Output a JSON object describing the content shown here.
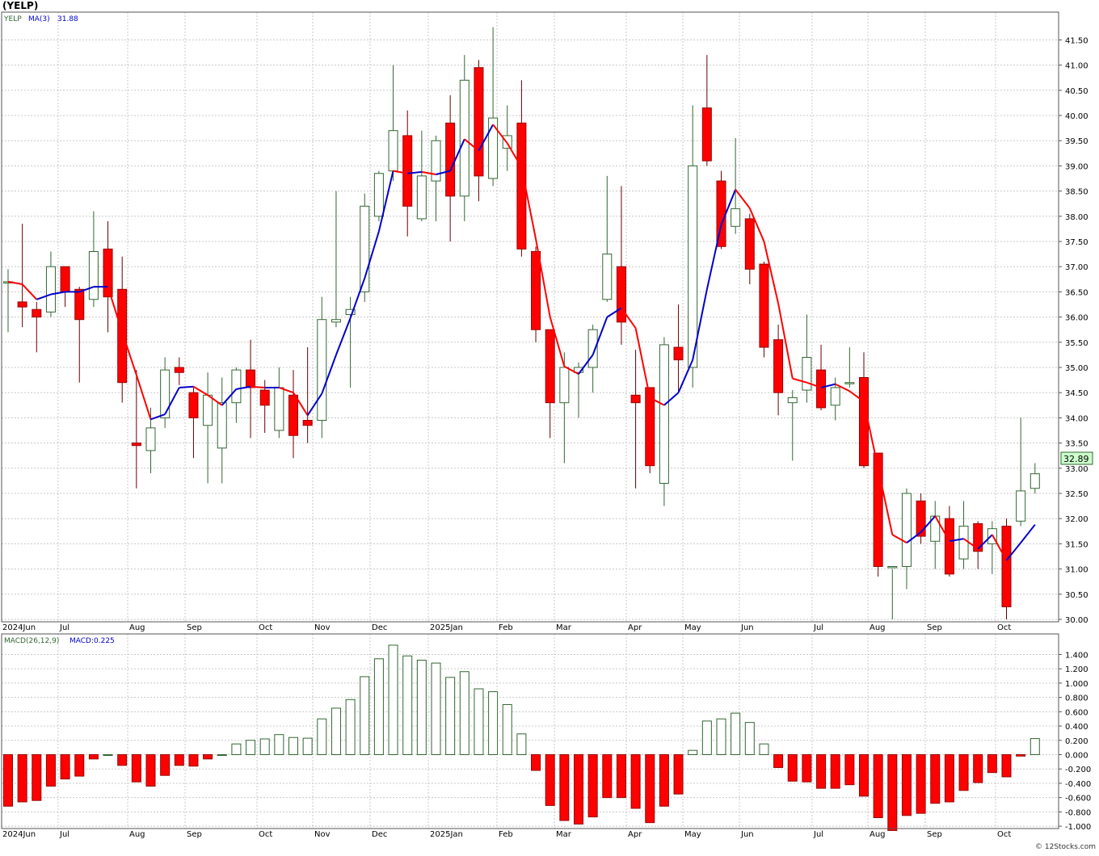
{
  "header": {
    "symbol_title": "(YELP)",
    "price_legend": {
      "symbol": "YELP",
      "ma_label": "MA(3)",
      "ma_value": "31.88"
    },
    "macd_legend": {
      "label": "MACD(26,12,9)",
      "value_label": "MACD:0.225"
    },
    "last_price": "32.89",
    "watermark": "© 12Stocks.com"
  },
  "colors": {
    "up_stroke": "#336633",
    "down_fill": "#ff0000",
    "ma_up": "#0000cc",
    "ma_down": "#ff0000",
    "grid": "#c8c8c8",
    "legend_text": "#336633",
    "legend_value": "#0000cc"
  },
  "x_labels": [
    "2024Jun",
    "Jul",
    "Aug",
    "Sep",
    "Oct",
    "Nov",
    "Dec",
    "2025Jan",
    "Feb",
    "Mar",
    "Apr",
    "May",
    "Jun",
    "Jul",
    "Aug",
    "Sep",
    "Oct"
  ],
  "chart_data": [
    {
      "type": "candlestick",
      "symbol": "YELP",
      "ylim": [
        29.95,
        41.9
      ],
      "y_ticks": [
        "30.00",
        "30.50",
        "31.00",
        "31.50",
        "32.00",
        "32.50",
        "33.00",
        "33.50",
        "34.00",
        "34.50",
        "35.00",
        "35.50",
        "36.00",
        "36.50",
        "37.00",
        "37.50",
        "38.00",
        "38.50",
        "39.00",
        "39.50",
        "40.00",
        "40.50",
        "41.00",
        "41.50"
      ],
      "grid": true,
      "candles": [
        [
          36.7,
          36.95,
          35.7,
          36.7
        ],
        [
          36.3,
          37.85,
          35.8,
          36.2
        ],
        [
          36.15,
          36.3,
          35.3,
          36.0
        ],
        [
          36.1,
          37.3,
          36.0,
          37.0
        ],
        [
          37.0,
          37.0,
          36.2,
          36.5
        ],
        [
          36.55,
          36.6,
          34.7,
          35.95
        ],
        [
          36.35,
          38.1,
          36.2,
          37.3
        ],
        [
          37.35,
          37.9,
          35.7,
          36.4
        ],
        [
          36.55,
          37.2,
          34.3,
          34.7
        ],
        [
          33.5,
          34.95,
          32.6,
          33.45
        ],
        [
          33.35,
          34.2,
          32.9,
          33.8
        ],
        [
          34.0,
          35.2,
          33.8,
          34.95
        ],
        [
          35.0,
          35.2,
          34.65,
          34.9
        ],
        [
          34.5,
          34.6,
          33.2,
          34.0
        ],
        [
          33.85,
          34.9,
          32.7,
          34.45
        ],
        [
          33.4,
          34.8,
          32.7,
          34.3
        ],
        [
          34.3,
          35.0,
          33.9,
          34.95
        ],
        [
          34.95,
          35.55,
          33.6,
          34.6
        ],
        [
          34.55,
          34.75,
          33.7,
          34.25
        ],
        [
          33.75,
          35.0,
          33.6,
          34.6
        ],
        [
          34.45,
          34.95,
          33.2,
          33.65
        ],
        [
          33.95,
          35.4,
          33.5,
          33.85
        ],
        [
          33.95,
          36.4,
          33.6,
          35.95
        ],
        [
          35.9,
          38.5,
          35.8,
          35.95
        ],
        [
          36.05,
          36.4,
          34.6,
          36.15
        ],
        [
          36.5,
          38.45,
          36.3,
          38.2
        ],
        [
          38.0,
          38.9,
          37.9,
          38.85
        ],
        [
          38.9,
          41.0,
          38.7,
          39.7
        ],
        [
          39.6,
          40.1,
          37.6,
          38.2
        ],
        [
          37.95,
          39.7,
          37.9,
          38.8
        ],
        [
          38.7,
          39.6,
          37.9,
          39.5
        ],
        [
          39.85,
          40.4,
          37.5,
          38.4
        ],
        [
          38.4,
          41.2,
          37.9,
          40.7
        ],
        [
          40.95,
          41.1,
          38.3,
          38.8
        ],
        [
          38.75,
          41.75,
          38.6,
          39.95
        ],
        [
          39.35,
          40.2,
          38.9,
          39.6
        ],
        [
          39.85,
          40.7,
          37.2,
          37.35
        ],
        [
          37.3,
          37.4,
          35.5,
          35.75
        ],
        [
          35.75,
          35.75,
          33.6,
          34.3
        ],
        [
          34.3,
          35.3,
          33.1,
          35.0
        ],
        [
          34.9,
          35.1,
          34.0,
          35.0
        ],
        [
          35.0,
          35.85,
          34.5,
          35.75
        ],
        [
          36.35,
          38.8,
          36.3,
          37.25
        ],
        [
          37.0,
          38.6,
          35.45,
          35.9
        ],
        [
          34.45,
          35.35,
          32.6,
          34.3
        ],
        [
          34.6,
          34.6,
          32.9,
          33.05
        ],
        [
          32.7,
          35.6,
          32.25,
          35.45
        ],
        [
          35.4,
          36.25,
          34.5,
          35.15
        ],
        [
          35.0,
          40.2,
          34.6,
          39.0
        ],
        [
          40.15,
          41.2,
          39.0,
          39.1
        ],
        [
          38.7,
          38.9,
          37.35,
          37.4
        ],
        [
          37.8,
          39.55,
          37.65,
          38.15
        ],
        [
          37.95,
          38.05,
          36.65,
          36.95
        ],
        [
          37.05,
          37.1,
          35.2,
          35.4
        ],
        [
          35.55,
          35.85,
          34.05,
          34.5
        ],
        [
          34.3,
          34.55,
          33.15,
          34.4
        ],
        [
          34.55,
          36.05,
          34.3,
          35.2
        ],
        [
          34.95,
          35.45,
          34.15,
          34.2
        ],
        [
          34.25,
          34.8,
          33.95,
          34.6
        ],
        [
          34.7,
          35.4,
          34.6,
          34.7
        ],
        [
          34.8,
          35.3,
          33.0,
          33.05
        ],
        [
          33.3,
          33.25,
          30.85,
          31.05
        ],
        [
          31.05,
          31.0,
          30.0,
          31.05
        ],
        [
          31.05,
          32.6,
          30.6,
          32.5
        ],
        [
          32.35,
          32.5,
          31.5,
          31.65
        ],
        [
          31.55,
          32.35,
          31.0,
          32.05
        ],
        [
          32.0,
          32.25,
          30.85,
          30.9
        ],
        [
          31.2,
          32.35,
          31.0,
          31.85
        ],
        [
          31.9,
          31.95,
          31.0,
          31.35
        ],
        [
          31.5,
          31.95,
          30.9,
          31.8
        ],
        [
          31.85,
          32.0,
          30.0,
          30.25
        ],
        [
          31.95,
          34.0,
          31.85,
          32.55
        ],
        [
          32.6,
          33.1,
          32.5,
          32.89
        ]
      ],
      "ma3": [
        36.7,
        36.65,
        36.35,
        36.45,
        36.5,
        36.5,
        36.6,
        36.6,
        35.7,
        34.85,
        33.97,
        34.07,
        34.6,
        34.62,
        34.45,
        34.25,
        34.57,
        34.62,
        34.6,
        34.6,
        34.5,
        34.05,
        34.48,
        35.25,
        35.98,
        36.77,
        37.7,
        38.9,
        38.85,
        38.88,
        38.83,
        38.9,
        39.53,
        39.3,
        39.82,
        39.45,
        38.97,
        37.55,
        36.0,
        35.02,
        34.87,
        35.25,
        36.0,
        36.18,
        35.78,
        34.4,
        34.25,
        34.5,
        35.15,
        36.55,
        37.83,
        38.53,
        38.16,
        37.5,
        36.27,
        34.78,
        34.7,
        34.6,
        34.67,
        34.53,
        34.32,
        33.0,
        31.68,
        31.52,
        31.73,
        32.05,
        31.55,
        31.6,
        31.4,
        31.68,
        31.17,
        31.52,
        31.88
      ]
    },
    {
      "type": "bar",
      "series_name": "MACD(26,12,9)",
      "ylim": [
        -1.06,
        1.55
      ],
      "y_ticks": [
        "-1.000",
        "-0.800",
        "-0.600",
        "-0.400",
        "-0.200",
        "0.000",
        "0.200",
        "0.400",
        "0.600",
        "0.800",
        "1.000",
        "1.200",
        "1.400"
      ],
      "grid": true,
      "values": [
        -0.72,
        -0.66,
        -0.64,
        -0.44,
        -0.34,
        -0.3,
        -0.06,
        0.0,
        -0.15,
        -0.38,
        -0.44,
        -0.29,
        -0.15,
        -0.16,
        -0.06,
        0.0,
        0.15,
        0.2,
        0.22,
        0.28,
        0.24,
        0.23,
        0.5,
        0.65,
        0.77,
        1.09,
        1.34,
        1.53,
        1.38,
        1.32,
        1.28,
        1.08,
        1.16,
        0.92,
        0.88,
        0.7,
        0.29,
        -0.22,
        -0.71,
        -0.92,
        -0.97,
        -0.87,
        -0.6,
        -0.6,
        -0.75,
        -0.95,
        -0.72,
        -0.55,
        0.06,
        0.47,
        0.5,
        0.58,
        0.45,
        0.15,
        -0.18,
        -0.37,
        -0.38,
        -0.47,
        -0.47,
        -0.42,
        -0.58,
        -0.88,
        -1.06,
        -0.85,
        -0.82,
        -0.68,
        -0.66,
        -0.5,
        -0.39,
        -0.25,
        -0.31,
        -0.02,
        0.225
      ]
    }
  ]
}
